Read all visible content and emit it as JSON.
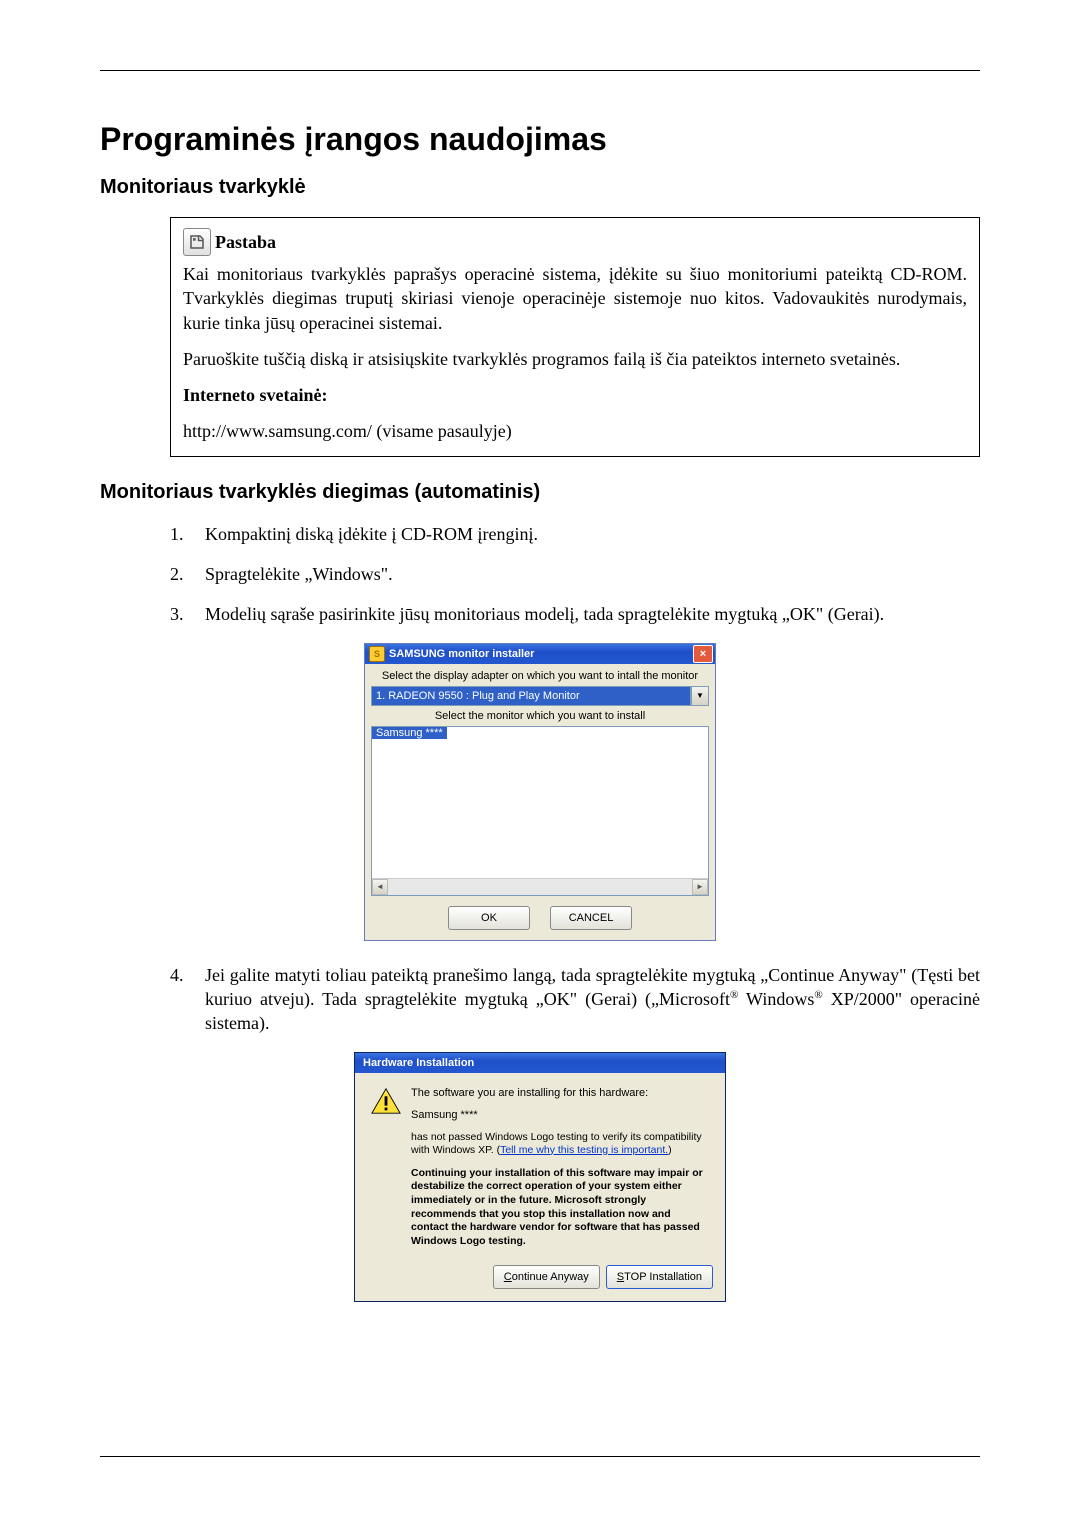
{
  "page": {
    "h1": "Programinės įrangos naudojimas",
    "h2a": "Monitoriaus tvarkyklė",
    "h2b": "Monitoriaus tvarkyklės diegimas (automatinis)"
  },
  "note": {
    "label": "Pastaba",
    "p1": "Kai monitoriaus tvarkyklės paprašys operacinė sistema, įdėkite su šiuo monitoriumi pateiktą CD-ROM. Tvarkyklės diegimas truputį skiriasi vienoje operacinėje sistemoje nuo kitos. Vadovaukitės nurodymais, kurie tinka jūsų operacinei sistemai.",
    "p2": "Paruoškite tuščią diską ir atsisiųskite tvarkyklės programos failą iš čia pateiktos interneto svetainės.",
    "p3bold": "Interneto svetainė:",
    "p4": "http://www.samsung.com/ (visame pasaulyje)"
  },
  "steps": {
    "s1": "Kompaktinį diską įdėkite į CD-ROM įrenginį.",
    "s2": "Spragtelėkite „Windows\".",
    "s3": "Modelių sąraše pasirinkite jūsų monitoriaus modelį, tada spragtelėkite mygtuką „OK\" (Gerai).",
    "s4a": "Jei galite matyti toliau pateiktą pranešimo langą, tada spragtelėkite mygtuką „Continue Anyway\" (Tęsti bet kuriuo atveju). Tada spragtelėkite mygtuką „OK\" (Gerai) („Microsoft",
    "s4b": " Windows",
    "s4c": " XP/2000\" operacinė sistema).",
    "reg": "®"
  },
  "installer": {
    "title": "SAMSUNG monitor installer",
    "instr1": "Select the display adapter on which you want to intall the monitor",
    "adapter": "1. RADEON 9550 : Plug and Play Monitor",
    "instr2": "Select the monitor which you want to install",
    "selected": "Samsung ****",
    "ok": "OK",
    "cancel": "CANCEL"
  },
  "hw": {
    "title": "Hardware Installation",
    "l1": "The software you are installing for this hardware:",
    "l2": "Samsung ****",
    "l3a": "has not passed Windows Logo testing to verify its compatibility with Windows XP. (",
    "l3link": "Tell me why this testing is important.",
    "l3b": ")",
    "warn": "Continuing your installation of this software may impair or destabilize the correct operation of your system either immediately or in the future. Microsoft strongly recommends that you stop this installation now and contact the hardware vendor for software that has passed Windows Logo testing.",
    "btn_cont_u": "C",
    "btn_cont_rest": "ontinue Anyway",
    "btn_stop_u": "S",
    "btn_stop_rest": "TOP Installation"
  }
}
